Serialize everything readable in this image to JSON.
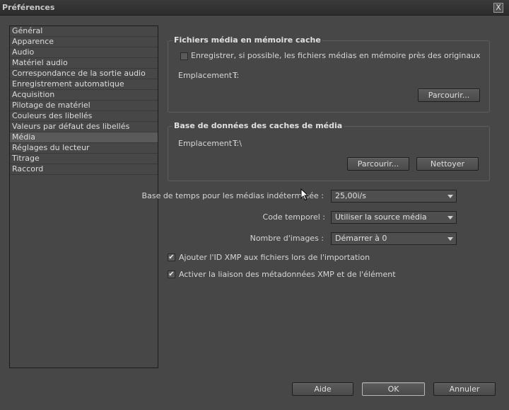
{
  "window": {
    "title": "Préférences",
    "close_label": "X"
  },
  "sidebar": {
    "items": [
      {
        "label": "Général"
      },
      {
        "label": "Apparence"
      },
      {
        "label": "Audio"
      },
      {
        "label": "Matériel audio"
      },
      {
        "label": "Correspondance de la sortie audio"
      },
      {
        "label": "Enregistrement automatique"
      },
      {
        "label": "Acquisition"
      },
      {
        "label": "Pilotage de matériel"
      },
      {
        "label": "Couleurs des libellés"
      },
      {
        "label": "Valeurs par défaut des libellés"
      },
      {
        "label": "Média"
      },
      {
        "label": "Réglages du lecteur"
      },
      {
        "label": "Titrage"
      },
      {
        "label": "Raccord"
      }
    ],
    "selected_index": 10
  },
  "cache_group": {
    "title": "Fichiers média en mémoire cache",
    "save_near_originals_label": "Enregistrer, si possible, les fichiers médias en mémoire près des originaux",
    "save_near_originals_checked": false,
    "location_label": "Emplacement :",
    "location_value": "T:",
    "browse_label": "Parcourir..."
  },
  "database_group": {
    "title": "Base de données des caches de média",
    "location_label": "Emplacement :",
    "location_value": "T:\\",
    "browse_label": "Parcourir...",
    "clean_label": "Nettoyer"
  },
  "settings": {
    "timebase_label": "Base de temps pour les médias indéterminée :",
    "timebase_value": "25,00i/s",
    "timecode_label": "Code temporel :",
    "timecode_value": "Utiliser la source média",
    "frame_count_label": "Nombre d'images :",
    "frame_count_value": "Démarrer à 0",
    "xmp_id_label": "Ajouter l'ID XMP aux fichiers lors de l'importation",
    "xmp_id_checked": true,
    "xmp_link_label": "Activer la liaison des métadonnées XMP et de l'élément",
    "xmp_link_checked": true
  },
  "footer": {
    "help_label": "Aide",
    "ok_label": "OK",
    "cancel_label": "Annuler"
  },
  "check_mark": "✔"
}
